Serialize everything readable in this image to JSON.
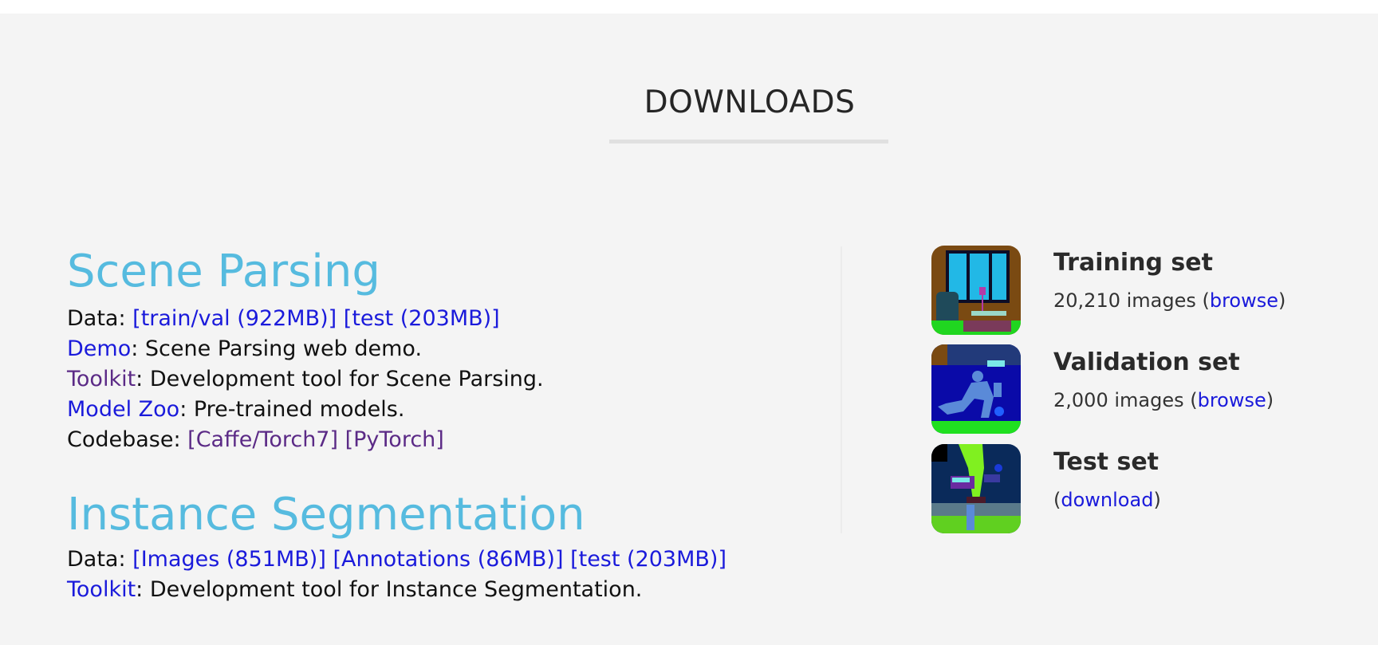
{
  "header": {
    "title": "DOWNLOADS"
  },
  "scene_parsing": {
    "title": "Scene Parsing",
    "data_label": "Data: ",
    "data_links": [
      "[train/val (922MB)]",
      "[test (203MB)]"
    ],
    "demo_link": "Demo",
    "demo_text": ": Scene Parsing web demo.",
    "toolkit_link": "Toolkit",
    "toolkit_text": ": Development tool for Scene Parsing.",
    "modelzoo_link": "Model Zoo",
    "modelzoo_text": ": Pre-trained models.",
    "codebase_label": "Codebase: ",
    "codebase_links": [
      "[Caffe/Torch7]",
      "[PyTorch]"
    ]
  },
  "instance_segmentation": {
    "title": "Instance Segmentation",
    "data_label": "Data: ",
    "data_links": [
      "[Images (851MB)]",
      "[Annotations (86MB)]",
      "[test (203MB)]"
    ],
    "toolkit_link": "Toolkit",
    "toolkit_text": ": Development tool for Instance Segmentation."
  },
  "sets": [
    {
      "title": "Training set",
      "info_prefix": "20,210 images (",
      "link": "browse",
      "info_suffix": ")",
      "thumb": "training-thumbnail"
    },
    {
      "title": "Validation set",
      "info_prefix": "2,000 images (",
      "link": "browse",
      "info_suffix": ")",
      "thumb": "validation-thumbnail"
    },
    {
      "title": "Test set",
      "info_prefix": "(",
      "link": "download",
      "info_suffix": ")",
      "thumb": "test-thumbnail"
    }
  ],
  "colors": {
    "heading": "#56bbdf",
    "link": "#1a1adb",
    "visited_link": "#5b2a86",
    "background": "#f4f4f4"
  }
}
